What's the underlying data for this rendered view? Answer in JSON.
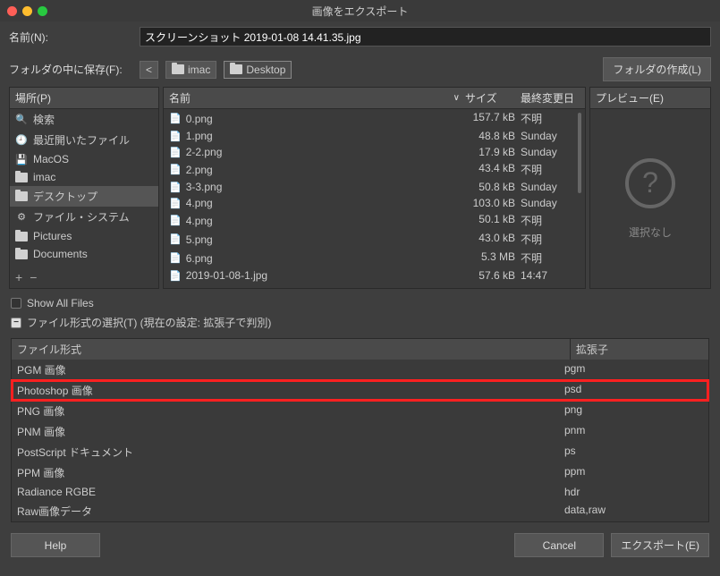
{
  "title": "画像をエクスポート",
  "name_label": "名前(N):",
  "filename": "スクリーンショット 2019-01-08 14.41.35.jpg",
  "folder_label": "フォルダの中に保存(F):",
  "breadcrumbs": {
    "back": "<",
    "item1": "imac",
    "item2": "Desktop"
  },
  "create_folder": "フォルダの作成(L)",
  "places_header": "場所(P)",
  "places": [
    {
      "icon": "search",
      "label": "検索"
    },
    {
      "icon": "recent",
      "label": "最近開いたファイル"
    },
    {
      "icon": "disk",
      "label": "MacOS"
    },
    {
      "icon": "folder",
      "label": "imac"
    },
    {
      "icon": "folder",
      "label": "デスクトップ",
      "active": true
    },
    {
      "icon": "cog",
      "label": "ファイル・システム"
    },
    {
      "icon": "folder",
      "label": "Pictures"
    },
    {
      "icon": "folder",
      "label": "Documents"
    }
  ],
  "add": "+",
  "remove": "−",
  "file_headers": {
    "name": "名前",
    "size": "サイズ",
    "date": "最終変更日"
  },
  "files": [
    {
      "name": "0.png",
      "size": "157.7 kB",
      "date": "不明"
    },
    {
      "name": "1.png",
      "size": "48.8 kB",
      "date": "Sunday"
    },
    {
      "name": "2-2.png",
      "size": "17.9 kB",
      "date": "Sunday"
    },
    {
      "name": "2.png",
      "size": "43.4 kB",
      "date": "不明"
    },
    {
      "name": "3-3.png",
      "size": "50.8 kB",
      "date": "Sunday"
    },
    {
      "name": "4.png",
      "size": "103.0 kB",
      "date": "Sunday"
    },
    {
      "name": "4.png",
      "size": "50.1 kB",
      "date": "不明"
    },
    {
      "name": "5.png",
      "size": "43.0 kB",
      "date": "不明"
    },
    {
      "name": "6.png",
      "size": "5.3 MB",
      "date": "不明"
    },
    {
      "name": "2019-01-08-1.jpg",
      "size": "57.6 kB",
      "date": "14:47"
    }
  ],
  "preview_header": "プレビュー(E)",
  "preview_none": "選択なし",
  "show_all": "Show All Files",
  "select_format": "ファイル形式の選択(T) (現在の設定: 拡張子で判別)",
  "format_headers": {
    "type": "ファイル形式",
    "ext": "拡張子"
  },
  "formats": [
    {
      "type": "PGM 画像",
      "ext": "pgm"
    },
    {
      "type": "Photoshop 画像",
      "ext": "psd",
      "hilite": true
    },
    {
      "type": "PNG 画像",
      "ext": "png"
    },
    {
      "type": "PNM 画像",
      "ext": "pnm"
    },
    {
      "type": "PostScript ドキュメント",
      "ext": "ps"
    },
    {
      "type": "PPM 画像",
      "ext": "ppm"
    },
    {
      "type": "Radiance RGBE",
      "ext": "hdr"
    },
    {
      "type": "Raw画像データ",
      "ext": "data,raw"
    }
  ],
  "buttons": {
    "help": "Help",
    "cancel": "Cancel",
    "export": "エクスポート(E)"
  }
}
